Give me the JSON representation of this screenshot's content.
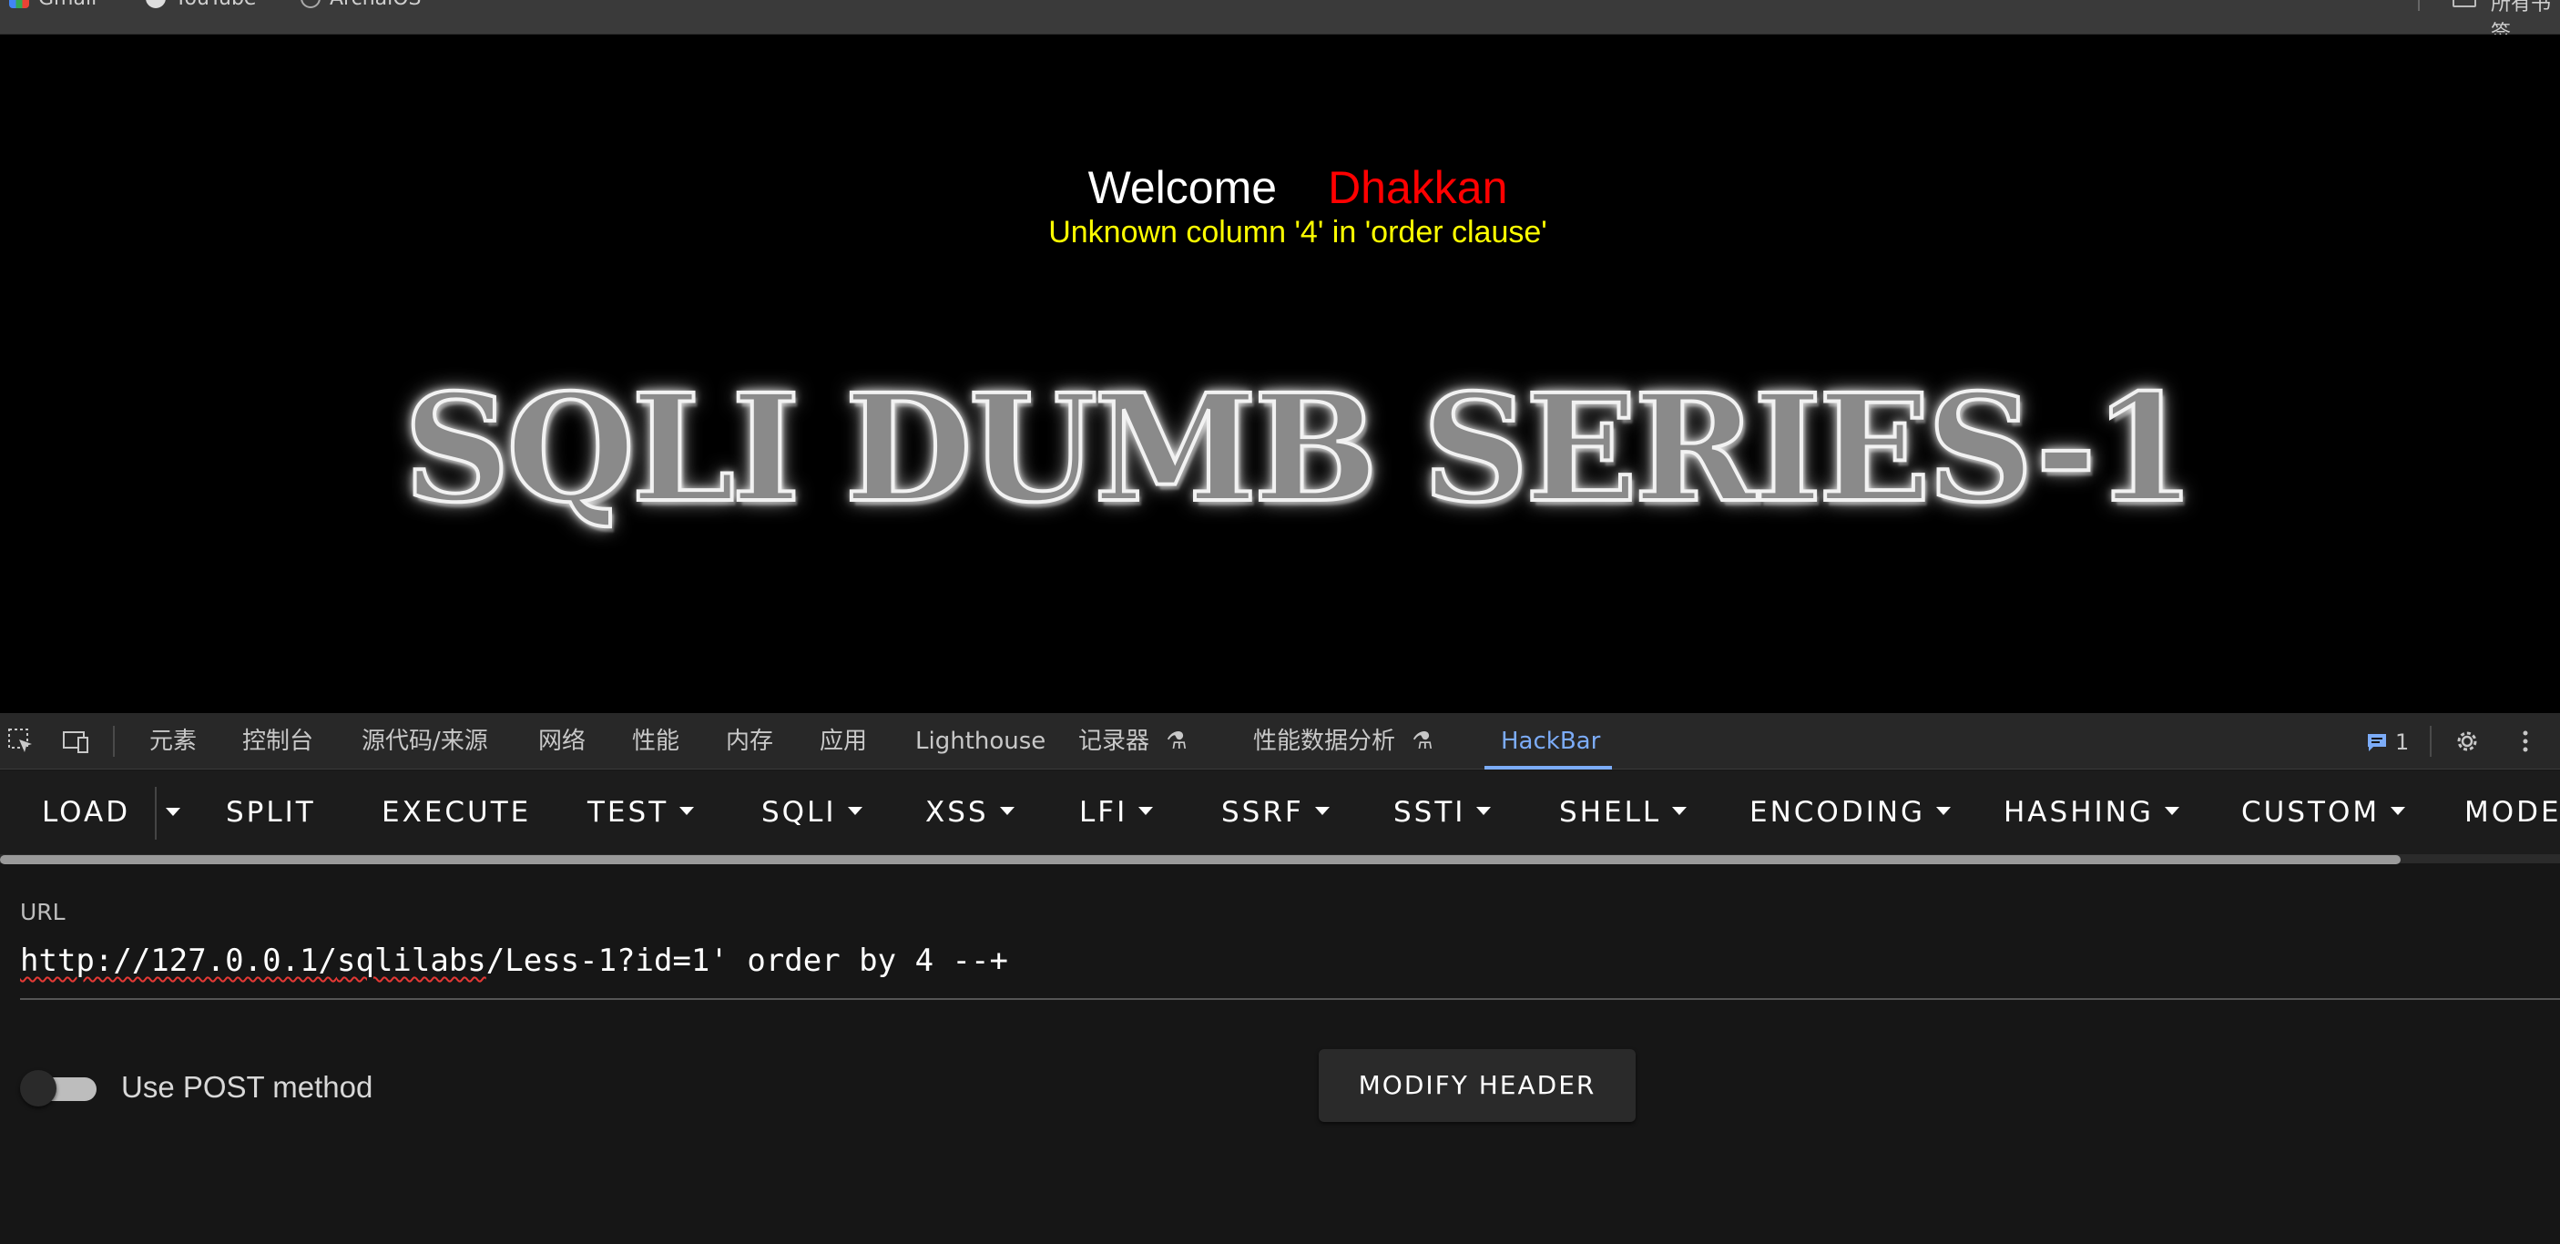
{
  "bookmarks": {
    "items": [
      {
        "label": "Gmail",
        "icon": "gmail-icon"
      },
      {
        "label": "YouTube",
        "icon": "github-icon"
      },
      {
        "label": "ArchaiOS",
        "icon": "openai-icon"
      }
    ],
    "right_label": "所有书签"
  },
  "page": {
    "welcome_text": "Welcome",
    "user_name": "Dhakkan",
    "error_message": "Unknown column '4' in 'order clause'",
    "banner_text": "SQLI DUMB SERIES-1"
  },
  "devtools": {
    "tabs": [
      "元素",
      "控制台",
      "源代码/来源",
      "网络",
      "性能",
      "内存",
      "应用",
      "Lighthouse",
      "记录器",
      "性能数据分析",
      "HackBar"
    ],
    "active_tab": "HackBar",
    "message_count": "1",
    "colors": {
      "accent": "#7cacf8",
      "background": "#161616"
    }
  },
  "hackbar": {
    "toolbar": [
      "LOAD",
      "SPLIT",
      "EXECUTE",
      "TEST",
      "SQLI",
      "XSS",
      "LFI",
      "SSRF",
      "SSTI",
      "SHELL",
      "ENCODING",
      "HASHING",
      "CUSTOM",
      "MODE"
    ],
    "url_label": "URL",
    "url_part1": "http://127.0.0.1/",
    "url_part2": "sqlilabs",
    "url_part3": "/Less-1?id=1' order by 4 --+",
    "post_label": "Use POST method",
    "post_enabled": false,
    "modify_header_label": "MODIFY HEADER"
  }
}
